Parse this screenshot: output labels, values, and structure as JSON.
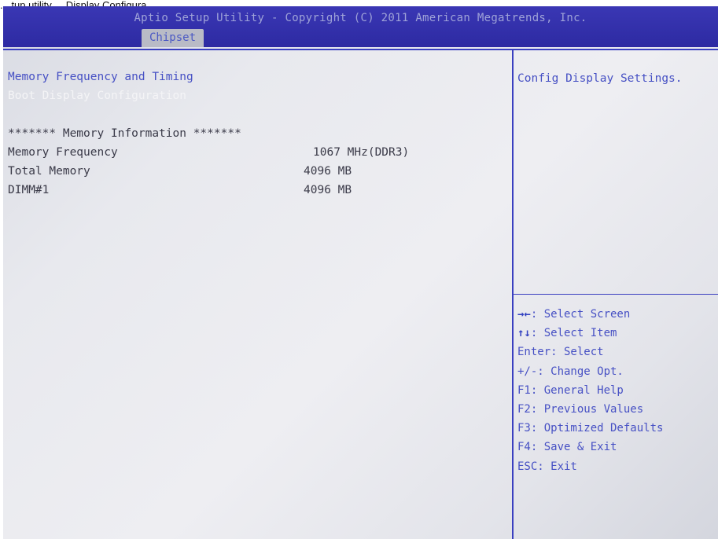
{
  "caption": "... tup utility ... Display Configura...",
  "header": {
    "title": "Aptio Setup Utility - Copyright (C) 2011 American Megatrends, Inc.",
    "active_tab": "Chipset"
  },
  "main": {
    "menu_items": [
      {
        "label": "Memory Frequency and Timing"
      },
      {
        "label": "Boot Display Configuration"
      }
    ],
    "section_heading": "******* Memory Information *******",
    "info_rows": [
      {
        "label": "Memory Frequency",
        "value": "1067 MHz(DDR3)"
      },
      {
        "label": "Total Memory",
        "value": "4096 MB"
      },
      {
        "label": "DIMM#1",
        "value": "4096 MB"
      }
    ]
  },
  "help": {
    "text": "Config Display Settings."
  },
  "legend": [
    {
      "key": "→←",
      "desc": ": Select Screen"
    },
    {
      "key": "↑↓",
      "desc": ": Select Item"
    },
    {
      "key": "",
      "desc": "Enter: Select"
    },
    {
      "key": "",
      "desc": "+/-: Change Opt."
    },
    {
      "key": "",
      "desc": "F1: General Help"
    },
    {
      "key": "",
      "desc": "F2: Previous Values"
    },
    {
      "key": "",
      "desc": "F3: Optimized Defaults"
    },
    {
      "key": "",
      "desc": "F4: Save & Exit"
    },
    {
      "key": "",
      "desc": "ESC: Exit"
    }
  ],
  "colors": {
    "header_bg": "#2d2aa2",
    "accent_blue": "#4650c4",
    "frame_line": "#3a3fc0",
    "screen_bg": "#e8e9ee",
    "highlight_text": "#f4f4f6"
  }
}
